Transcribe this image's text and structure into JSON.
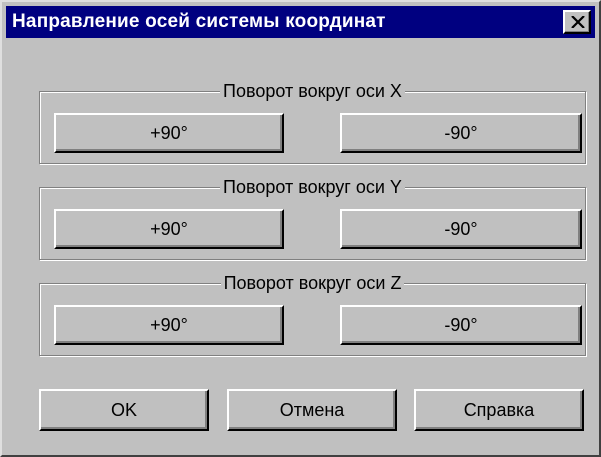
{
  "window": {
    "title": "Направление осей системы координат",
    "close_icon": "close-icon"
  },
  "groups": [
    {
      "label": "Поворот вокруг оси X",
      "plus": "+90°",
      "minus": "-90°"
    },
    {
      "label": "Поворот вокруг оси Y",
      "plus": "+90°",
      "minus": "-90°"
    },
    {
      "label": "Поворот вокруг оси Z",
      "plus": "+90°",
      "minus": "-90°"
    }
  ],
  "buttons": {
    "ok": "OK",
    "cancel": "Отмена",
    "help": "Справка"
  },
  "colors": {
    "title_bar": "#000080",
    "face": "#c0c0c0"
  }
}
